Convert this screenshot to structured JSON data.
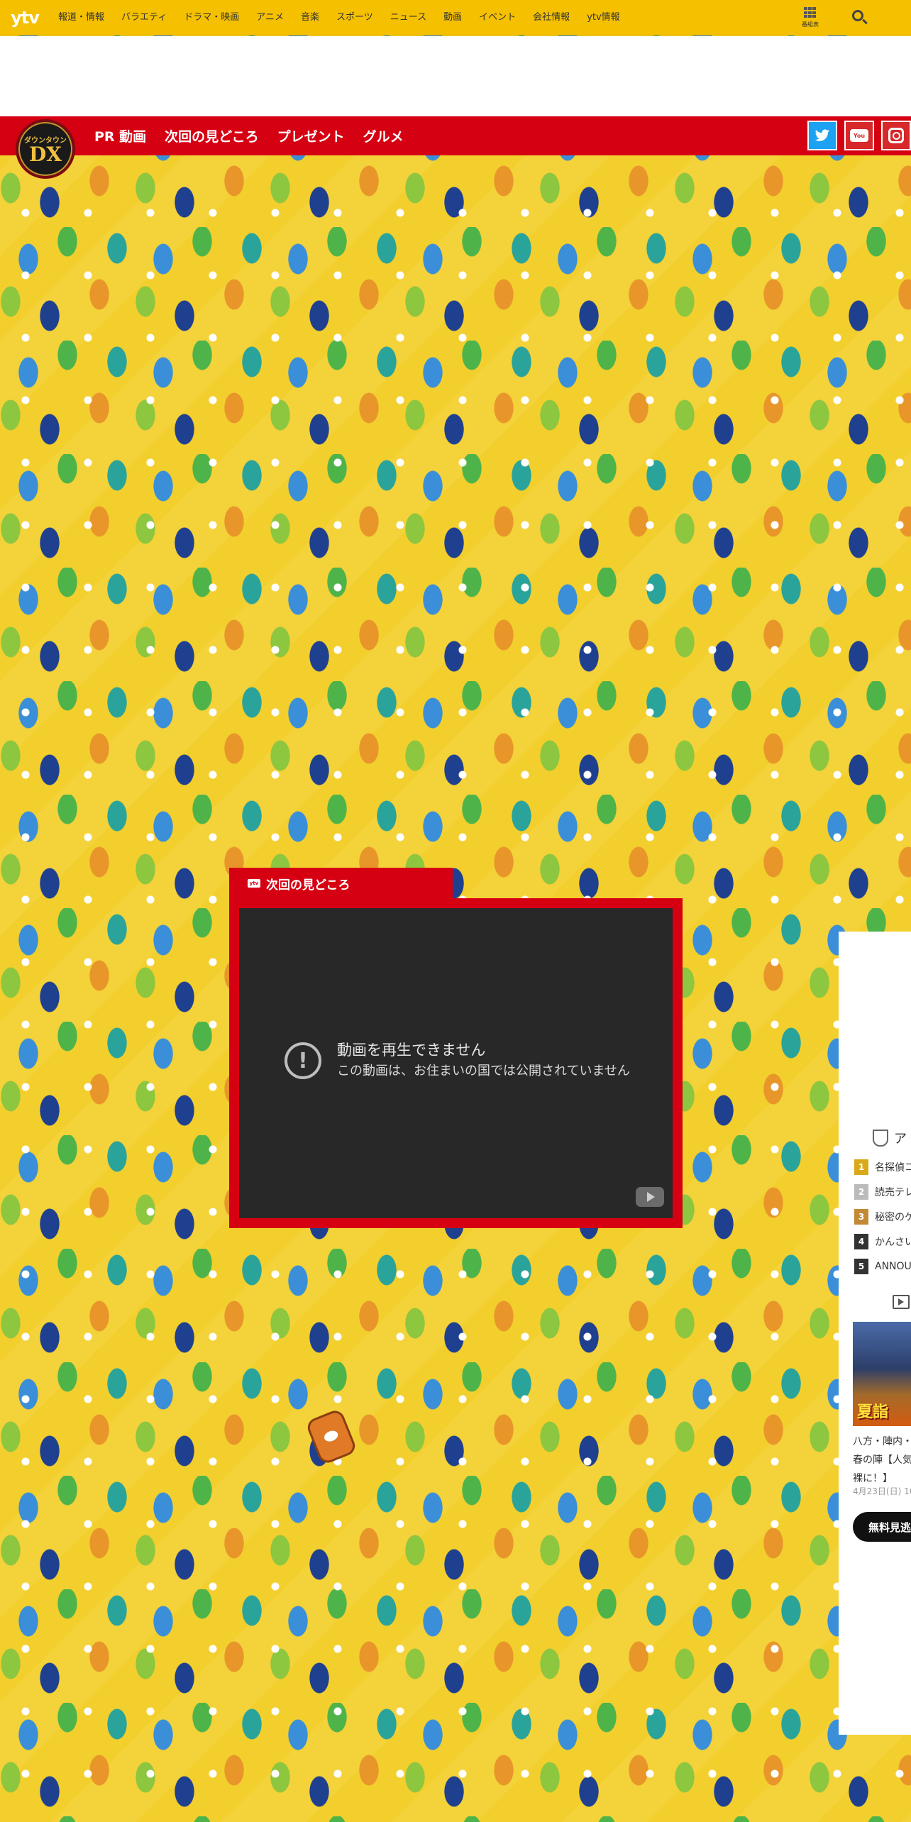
{
  "global_nav": {
    "logo": "ytv",
    "items": [
      "報道・情報",
      "バラエティ",
      "ドラマ・映画",
      "アニメ",
      "音楽",
      "スポーツ",
      "ニュース",
      "動画",
      "イベント",
      "会社情報",
      "ytv情報"
    ],
    "schedule_label": "番組表"
  },
  "program_nav": {
    "logo_small": "ダウンタウン",
    "logo_big": "DX",
    "links": [
      "PR 動画",
      "次回の見どころ",
      "プレゼント",
      "グルメ"
    ],
    "social": [
      "twitter-icon",
      "youtube-icon",
      "instagram-icon"
    ]
  },
  "video_section": {
    "tab_label": "次回の見どころ",
    "tab_icon": "ytv",
    "error_title": "動画を再生できません",
    "error_message": "この動画は、お住まいの国では公開されていません"
  },
  "sidebar": {
    "ranking_title": "ア",
    "ranking": [
      {
        "rank": "1",
        "title": "名探偵コ"
      },
      {
        "rank": "2",
        "title": "読売テレ"
      },
      {
        "rank": "3",
        "title": "秘密のケ"
      },
      {
        "rank": "4",
        "title": "かんさい"
      },
      {
        "rank": "5",
        "title": "ANNOU"
      }
    ],
    "video_card": {
      "thumb_text": "夏詣",
      "title_line1": "八方・陣内・",
      "title_line2": "春の陣【人気",
      "title_line3": "裸に！】",
      "date": "4月23日(日) 16",
      "cta": "無料見逃"
    }
  },
  "colors": {
    "topbar": "#f5c000",
    "brand_red": "#d60013",
    "background_yellow": "#f3cf2e",
    "player_bg": "#282828"
  }
}
